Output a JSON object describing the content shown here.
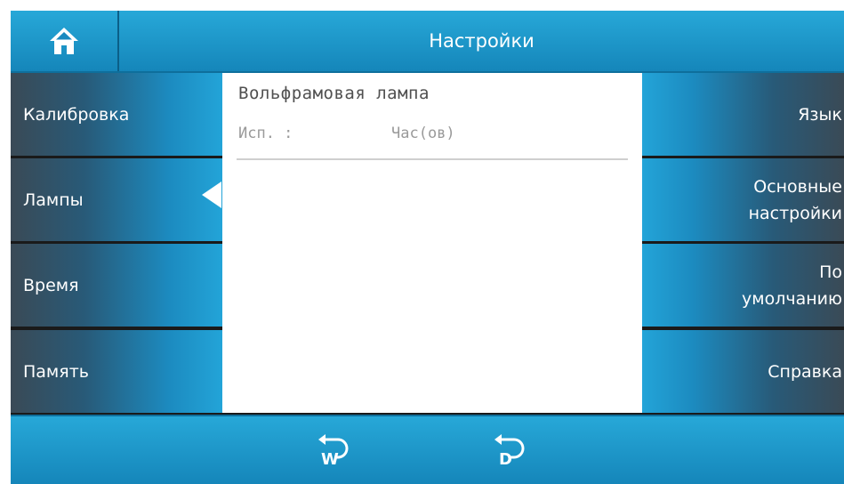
{
  "header": {
    "title": "Настройки",
    "home_icon": "home-icon"
  },
  "left_menu": [
    {
      "label": "Калибровка"
    },
    {
      "label": "Лампы"
    },
    {
      "label": "Время"
    },
    {
      "label": "Память"
    }
  ],
  "right_menu": [
    {
      "label": "Язык"
    },
    {
      "label_line1": "Основные",
      "label_line2": "настройки"
    },
    {
      "label_line1": "По",
      "label_line2": "умолчанию"
    },
    {
      "label": "Справка"
    }
  ],
  "content": {
    "lamp_name": "Вольфрамовая лампа",
    "usage_label": "Исп. :",
    "usage_unit": "Час(ов)"
  },
  "footer": {
    "tungsten_lamp_icon": "W",
    "deuterium_lamp_icon": "D"
  },
  "colors": {
    "accent": "#1f9bd0",
    "dark": "#3a4a56",
    "text_gray": "#9a9a9a"
  }
}
